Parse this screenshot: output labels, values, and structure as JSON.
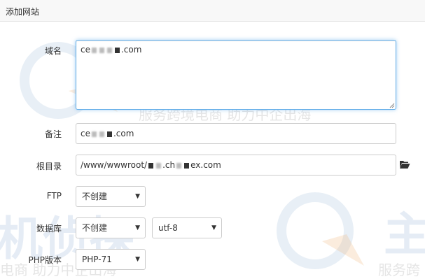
{
  "dialog": {
    "title": "添加网站"
  },
  "form": {
    "domain": {
      "label": "域名",
      "value_prefix": "ce",
      "value_suffix": ".com"
    },
    "remark": {
      "label": "备注",
      "value_prefix": "ce",
      "value_suffix": ".com"
    },
    "root_dir": {
      "label": "根目录",
      "value_prefix": "/www/wwwroot/",
      "value_middle": ".ch",
      "value_suffix": "ex.com",
      "browse_icon": "folder-open-icon"
    },
    "ftp": {
      "label": "FTP",
      "selected": "不创建"
    },
    "database": {
      "label": "数据库",
      "selected": "不创建",
      "charset_selected": "utf-8"
    },
    "php": {
      "label": "PHP版本",
      "selected": "PHP-71"
    }
  },
  "watermark": {
    "brand": "主机侦探",
    "slogan": "服务跨境电商 助力中企出海",
    "brand_bottom_left": "机侦探",
    "slogan_bottom_left": "电商 助力中企出海",
    "brand_bottom_right": "主",
    "slogan_bottom_right": "服务跨"
  },
  "colors": {
    "focus_border": "#66afe9",
    "title_bar_bg": "#f8f8f8"
  }
}
